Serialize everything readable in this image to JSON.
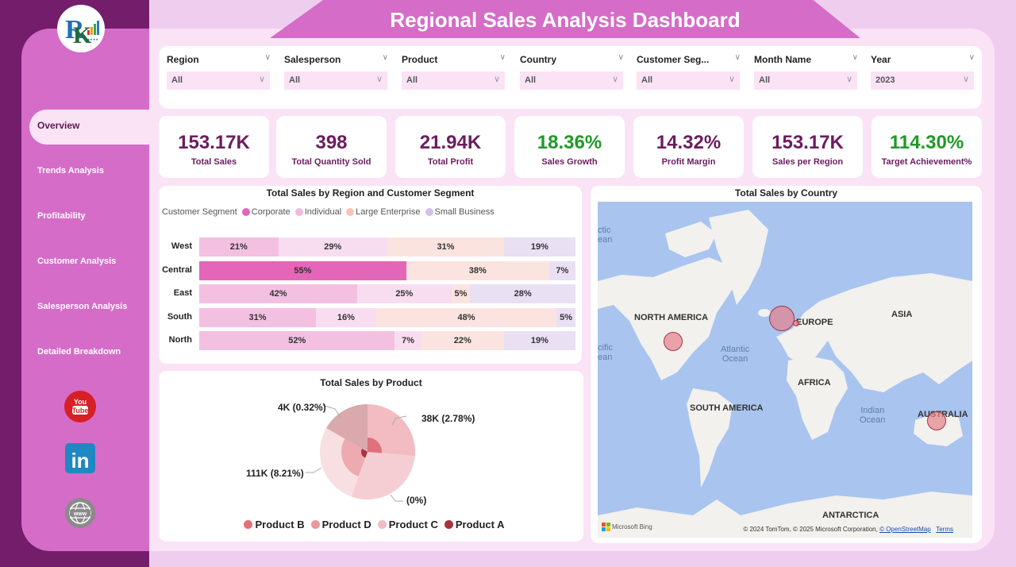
{
  "header": {
    "title": "Regional Sales Analysis Dashboard"
  },
  "sidebar": {
    "logo_icon": "rk-logo-icon",
    "items": [
      {
        "label": "Overview",
        "active": true
      },
      {
        "label": "Trends Analysis",
        "active": false
      },
      {
        "label": "Profitability",
        "active": false
      },
      {
        "label": "Customer Analysis",
        "active": false
      },
      {
        "label": "Salesperson Analysis",
        "active": false
      },
      {
        "label": "Detailed Breakdown",
        "active": false
      }
    ],
    "social": [
      "youtube-icon",
      "linkedin-icon",
      "globe-www-icon"
    ]
  },
  "filters": [
    {
      "label": "Region",
      "value": "All"
    },
    {
      "label": "Salesperson",
      "value": "All"
    },
    {
      "label": "Product",
      "value": "All"
    },
    {
      "label": "Country",
      "value": "All"
    },
    {
      "label": "Customer Seg...",
      "value": "All"
    },
    {
      "label": "Month Name",
      "value": "All"
    },
    {
      "label": "Year",
      "value": "2023"
    }
  ],
  "kpis": [
    {
      "value": "153.17K",
      "label": "Total Sales",
      "color": "#6b1d5f"
    },
    {
      "value": "398",
      "label": "Total Quantity Sold",
      "color": "#6b1d5f"
    },
    {
      "value": "21.94K",
      "label": "Total Profit",
      "color": "#6b1d5f"
    },
    {
      "value": "18.36%",
      "label": "Sales Growth",
      "color": "#1f9a28"
    },
    {
      "value": "14.32%",
      "label": "Profit Margin",
      "color": "#6b1d5f"
    },
    {
      "value": "153.17K",
      "label": "Sales per Region",
      "color": "#6b1d5f"
    },
    {
      "value": "114.30%",
      "label": "Target Achievement%",
      "color": "#2e9b3a"
    }
  ],
  "chart_data": [
    {
      "type": "bar",
      "orientation": "horizontal-100%-stacked",
      "title": "Total Sales by Region and Customer Segment",
      "legend_title": "Customer Segment",
      "legend_position": "top-left",
      "categories": [
        "West",
        "Central",
        "East",
        "South",
        "North"
      ],
      "series": [
        {
          "name": "Corporate",
          "color": "#e466b8",
          "values": [
            0,
            55,
            0,
            0,
            0
          ]
        },
        {
          "name": "Individual",
          "color": "#f3c0e2",
          "values": [
            21,
            0,
            42,
            31,
            52
          ]
        },
        {
          "name": "Individual-light",
          "color": "#f8ddf0",
          "values": [
            29,
            0,
            25,
            16,
            7
          ]
        },
        {
          "name": "Large Enterprise",
          "color": "#fbe4df",
          "values": [
            31,
            38,
            5,
            48,
            22
          ]
        },
        {
          "name": "Small Business",
          "color": "#e9e0f4",
          "values": [
            19,
            7,
            28,
            5,
            19
          ]
        }
      ],
      "legend": [
        {
          "name": "Corporate",
          "color": "#e466b8"
        },
        {
          "name": "Individual",
          "color": "#f2b8de"
        },
        {
          "name": "Large Enterprise",
          "color": "#f7c4b5"
        },
        {
          "name": "Small Business",
          "color": "#d2c0ec"
        }
      ]
    },
    {
      "type": "pie",
      "title": "Total Sales by Product",
      "legend_position": "bottom",
      "slices": [
        {
          "label": "38K (2.78%)",
          "value": 38,
          "percent": 2.78
        },
        {
          "label": "(0%)",
          "value": 0,
          "percent": 0
        },
        {
          "label": "111K (8.21%)",
          "value": 111,
          "percent": 8.21
        },
        {
          "label": "4K (0.32%)",
          "value": 4,
          "percent": 0.32
        }
      ],
      "legend": [
        {
          "name": "Product B",
          "color": "#e0707c"
        },
        {
          "name": "Product D",
          "color": "#e8989f"
        },
        {
          "name": "Product C",
          "color": "#f2bcc2"
        },
        {
          "name": "Product A",
          "color": "#a8323f"
        }
      ]
    }
  ],
  "map": {
    "title": "Total Sales by Country",
    "labels": {
      "north_america": "NORTH AMERICA",
      "europe": "EUROPE",
      "asia": "ASIA",
      "africa": "AFRICA",
      "south_america": "SOUTH AMERICA",
      "australia": "AUSTRALIA",
      "antarctica": "ANTARCTICA",
      "atlantic": "Atlantic\nOcean",
      "indian": "Indian\nOcean",
      "arctic": "ctic\nean",
      "pacific": "cific\nean"
    },
    "bubbles": [
      {
        "name": "United States",
        "size": "medium"
      },
      {
        "name": "United Kingdom/France",
        "size": "large"
      },
      {
        "name": "Germany",
        "size": "small"
      },
      {
        "name": "Australia",
        "size": "medium"
      }
    ],
    "bing": "Microsoft Bing",
    "attribution": "© 2024 TomTom, © 2025 Microsoft Corporation,",
    "osm_link": "© OpenStreetMap",
    "terms_link": "Terms"
  }
}
